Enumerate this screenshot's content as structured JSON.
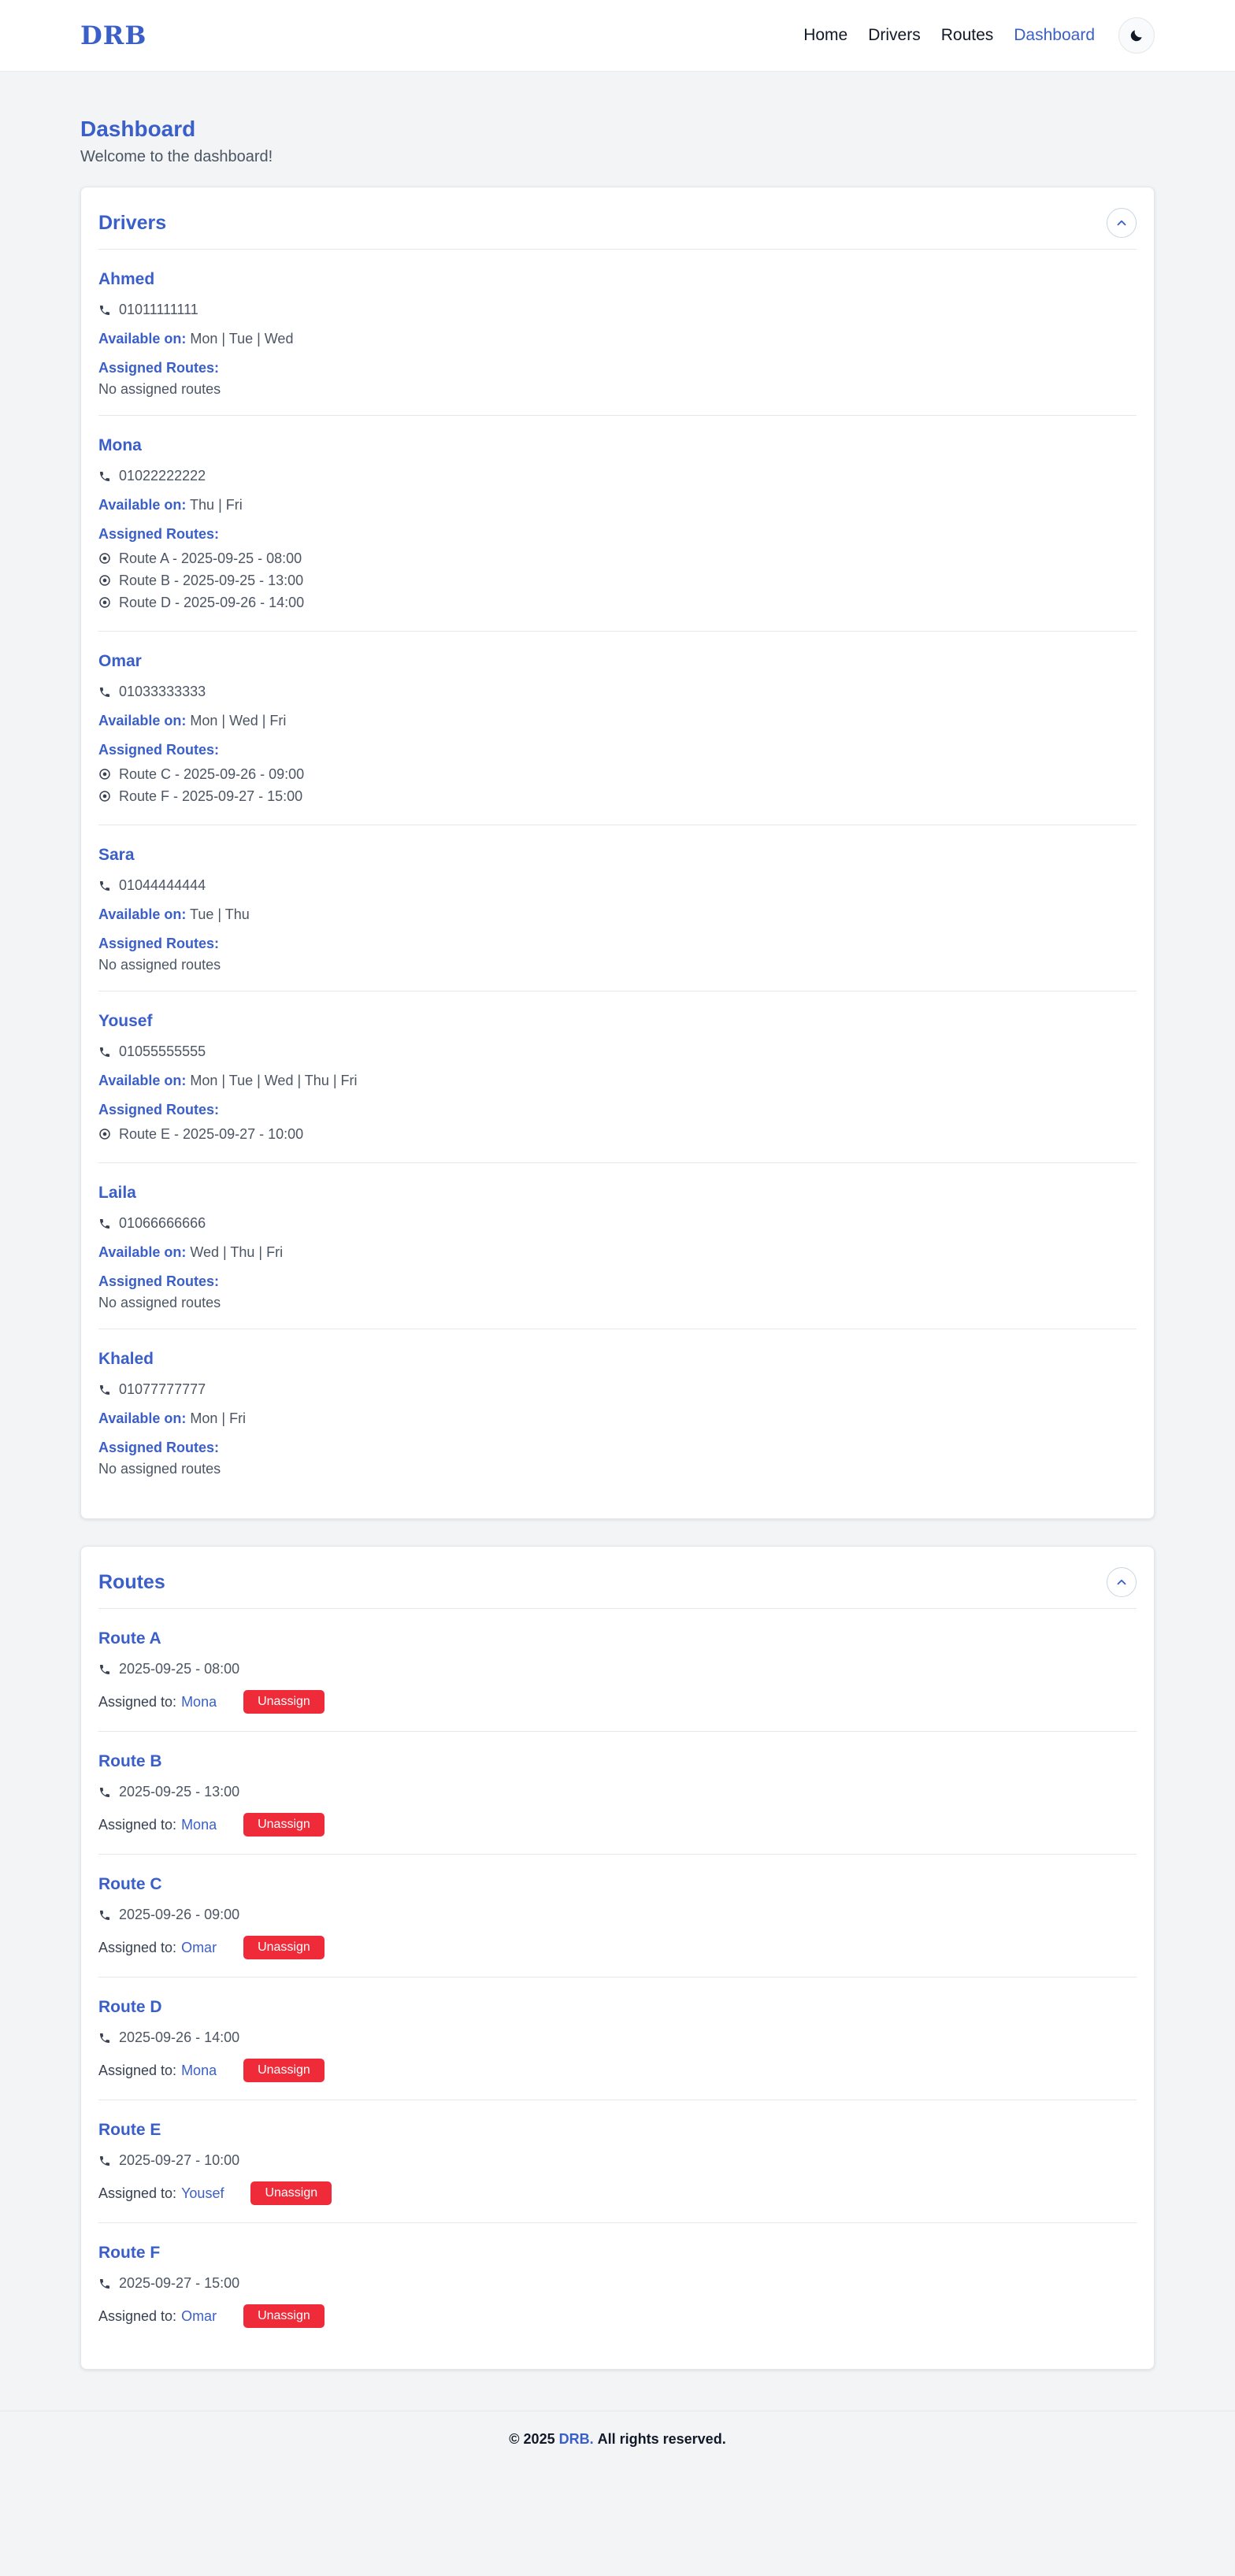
{
  "header": {
    "logo": "DRB",
    "nav": [
      "Home",
      "Drivers",
      "Routes",
      "Dashboard"
    ],
    "active": "Dashboard",
    "theme_icon": "moon-icon"
  },
  "page": {
    "title": "Dashboard",
    "subtitle": "Welcome to the dashboard!"
  },
  "drivers_section": {
    "title": "Drivers",
    "available_label": "Available on:",
    "assigned_label": "Assigned Routes:",
    "no_routes": "No assigned routes",
    "items": [
      {
        "name": "Ahmed",
        "phone": "01011111111",
        "available": "Mon | Tue | Wed",
        "routes": []
      },
      {
        "name": "Mona",
        "phone": "01022222222",
        "available": "Thu | Fri",
        "routes": [
          "Route A - 2025-09-25 - 08:00",
          "Route B - 2025-09-25 - 13:00",
          "Route D - 2025-09-26 - 14:00"
        ]
      },
      {
        "name": "Omar",
        "phone": "01033333333",
        "available": "Mon | Wed | Fri",
        "routes": [
          "Route C - 2025-09-26 - 09:00",
          "Route F - 2025-09-27 - 15:00"
        ]
      },
      {
        "name": "Sara",
        "phone": "01044444444",
        "available": "Tue | Thu",
        "routes": []
      },
      {
        "name": "Yousef",
        "phone": "01055555555",
        "available": "Mon | Tue | Wed | Thu | Fri",
        "routes": [
          "Route E - 2025-09-27 - 10:00"
        ]
      },
      {
        "name": "Laila",
        "phone": "01066666666",
        "available": "Wed | Thu | Fri",
        "routes": []
      },
      {
        "name": "Khaled",
        "phone": "01077777777",
        "available": "Mon | Fri",
        "routes": []
      }
    ]
  },
  "routes_section": {
    "title": "Routes",
    "assigned_to_label": "Assigned to:",
    "unassign_label": "Unassign",
    "items": [
      {
        "name": "Route A",
        "datetime": "2025-09-25 - 08:00",
        "driver": "Mona"
      },
      {
        "name": "Route B",
        "datetime": "2025-09-25 - 13:00",
        "driver": "Mona"
      },
      {
        "name": "Route C",
        "datetime": "2025-09-26 - 09:00",
        "driver": "Omar"
      },
      {
        "name": "Route D",
        "datetime": "2025-09-26 - 14:00",
        "driver": "Mona"
      },
      {
        "name": "Route E",
        "datetime": "2025-09-27 - 10:00",
        "driver": "Yousef"
      },
      {
        "name": "Route F",
        "datetime": "2025-09-27 - 15:00",
        "driver": "Omar"
      }
    ]
  },
  "footer": {
    "prefix": "© 2025",
    "brand": "DRB.",
    "suffix": "All rights reserved."
  },
  "colors": {
    "accent": "#3a5fc8",
    "danger": "#ef2b3a",
    "background": "#f3f4f6"
  }
}
